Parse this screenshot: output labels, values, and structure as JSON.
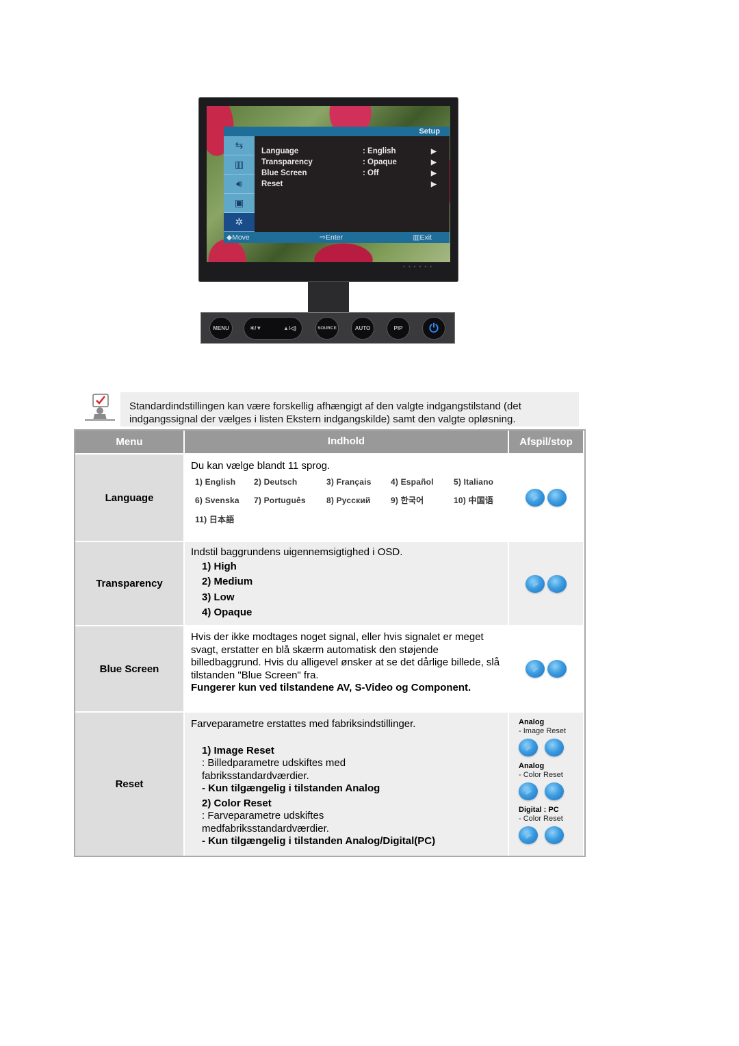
{
  "monitor": {
    "osd": {
      "title": "Setup",
      "side_icons": [
        "input-icon",
        "picture-icon",
        "sound-icon",
        "pip-icon",
        "setup-gear-icon"
      ],
      "items": [
        {
          "label": "Language",
          "value": ": English",
          "arrow": "▶"
        },
        {
          "label": "Transparency",
          "value": ": Opaque",
          "arrow": "▶"
        },
        {
          "label": "Blue Screen",
          "value": ": Off",
          "arrow": "▶"
        },
        {
          "label": "Reset",
          "value": "",
          "arrow": "▶"
        }
      ],
      "footer": {
        "move": "◆Move",
        "enter": "⇨Enter",
        "exit": "▥Exit"
      }
    },
    "buttons": {
      "menu": "MENU",
      "brightness_down": "☀/▼",
      "up_volume": "▲/◁)",
      "source": "SOURCE",
      "auto": "AUTO",
      "pip": "PIP",
      "power": "⏻"
    }
  },
  "note": {
    "icon": "note-checkmark-icon",
    "text": "Standardindstillingen kan være forskellig afhængigt af den valgte indgangstilstand (det indgangssignal der vælges i listen Ekstern indgangskilde) samt den valgte opløsning."
  },
  "table": {
    "headers": {
      "menu": "Menu",
      "content": "Indhold",
      "play": "Afspil/stop"
    },
    "language": {
      "label": "Language",
      "intro": "Du kan vælge blandt 11 sprog.",
      "options": [
        "1) English",
        "2) Deutsch",
        "3) Français",
        "4) Español",
        "5) Italiano",
        "6) Svenska",
        "7) Português",
        "8) Русский",
        "9) 한국어",
        "10) 中国语",
        "11) 日本語"
      ]
    },
    "transparency": {
      "label": "Transparency",
      "intro": "Indstil baggrundens uigennemsigtighed i OSD.",
      "options": [
        "1) High",
        "2) Medium",
        "3) Low",
        "4) Opaque"
      ]
    },
    "blue_screen": {
      "label": "Blue Screen",
      "text": "Hvis der ikke modtages noget signal, eller hvis signalet er meget svagt, erstatter en blå skærm automatisk den støjende billedbaggrund. Hvis du alligevel ønsker at se det dårlige billede, slå tilstanden \"Blue Screen\" fra.",
      "note": "Fungerer kun ved tilstandene AV, S-Video og Component."
    },
    "reset": {
      "label": "Reset",
      "intro": "Farveparametre erstattes med fabriksindstillinger.",
      "image_reset_title": "1) Image Reset",
      "image_reset_desc": ": Billedparametre udskiftes med fabriksstandardværdier.",
      "image_reset_note": "- Kun tilgængelig i tilstanden Analog",
      "color_reset_title": "2) Color Reset",
      "color_reset_desc": ": Farveparametre udskiftes medfabriksstandardværdier.",
      "color_reset_note": "- Kun tilgængelig i tilstanden Analog/Digital(PC)",
      "demos": [
        {
          "mode": "Analog",
          "item": "- Image Reset"
        },
        {
          "mode": "Analog",
          "item": "- Color Reset"
        },
        {
          "mode": "Digital : PC",
          "item": "- Color Reset"
        }
      ]
    }
  }
}
